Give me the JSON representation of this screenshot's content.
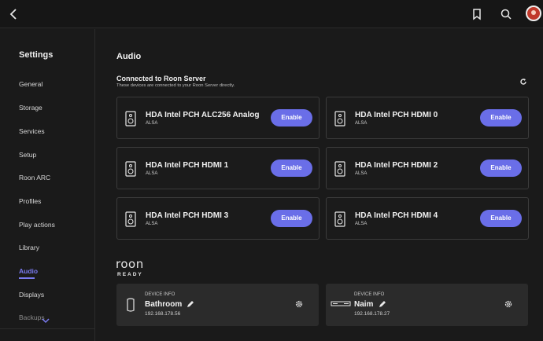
{
  "sidebar": {
    "title": "Settings",
    "items": [
      "General",
      "Storage",
      "Services",
      "Setup",
      "Roon ARC",
      "Profiles",
      "Play actions",
      "Library",
      "Audio",
      "Displays",
      "Backups"
    ],
    "active": "Audio"
  },
  "main": {
    "title": "Audio",
    "connected": {
      "title": "Connected to Roon Server",
      "subtitle": "These devices are connected to your Roon Server directly."
    },
    "devices": [
      {
        "name": "HDA Intel PCH ALC256 Analog",
        "sub": "ALSA",
        "button": "Enable"
      },
      {
        "name": "HDA Intel PCH HDMI 0",
        "sub": "ALSA",
        "button": "Enable"
      },
      {
        "name": "HDA Intel PCH HDMI 1",
        "sub": "ALSA",
        "button": "Enable"
      },
      {
        "name": "HDA Intel PCH HDMI 2",
        "sub": "ALSA",
        "button": "Enable"
      },
      {
        "name": "HDA Intel PCH HDMI 3",
        "sub": "ALSA",
        "button": "Enable"
      },
      {
        "name": "HDA Intel PCH HDMI 4",
        "sub": "ALSA",
        "button": "Enable"
      }
    ],
    "roon_ready": {
      "logo_text": "roon",
      "tag": "READY",
      "devices": [
        {
          "label": "DEVICE INFO",
          "name": "Bathroom",
          "ip": "192.168.178.56",
          "icon": "speaker-tower-icon"
        },
        {
          "label": "DEVICE INFO",
          "name": "Naim",
          "ip": "192.168.178.27",
          "icon": "streamer-box-icon"
        }
      ]
    }
  },
  "colors": {
    "accent": "#6a6ee8",
    "active_nav": "#7a7bf0",
    "background": "#1a1a1a"
  }
}
